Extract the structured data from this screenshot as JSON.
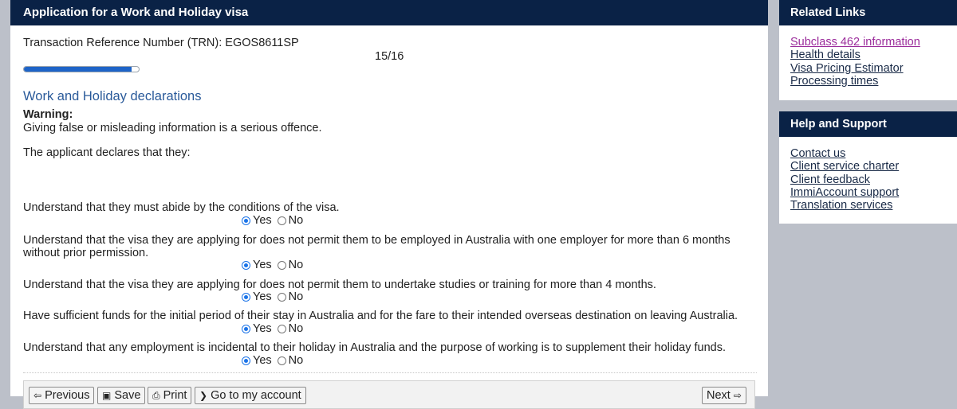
{
  "main": {
    "title": "Application for a Work and Holiday visa",
    "trn": "Transaction Reference Number (TRN): EGOS8611SP",
    "page_counter": "15/16",
    "progress": 0.9375,
    "section_title": "Work and Holiday declarations",
    "warning_label": "Warning:",
    "warning_text": "Giving false or misleading information is a serious offence.",
    "intro": "The applicant declares that they:",
    "questions": [
      {
        "text": "Understand that they must abide by the conditions of the visa.",
        "selected": "Yes"
      },
      {
        "text": "Understand that the visa they are applying for does not permit them to be employed in Australia with one employer for more than 6 months without prior permission.",
        "selected": "Yes"
      },
      {
        "text": "Understand that the visa they are applying for does not permit them to undertake studies or training for more than 4 months.",
        "selected": "Yes"
      },
      {
        "text": "Have sufficient funds for the initial period of their stay in Australia and for the fare to their intended overseas destination on leaving Australia.",
        "selected": "Yes"
      },
      {
        "text": "Understand that any employment is incidental to their holiday in Australia and the purpose of working is to supplement their holiday funds.",
        "selected": "Yes"
      }
    ],
    "yes_label": "Yes",
    "no_label": "No"
  },
  "toolbar": {
    "previous": "Previous",
    "save": "Save",
    "print": "Print",
    "account": "Go to my account",
    "next": "Next"
  },
  "related_links": {
    "title": "Related Links",
    "items": [
      "Subclass 462 information",
      "Health details",
      "Visa Pricing Estimator",
      "Processing times"
    ]
  },
  "help_support": {
    "title": "Help and Support",
    "items": [
      "Contact us",
      "Client service charter",
      "Client feedback",
      "ImmiAccount support",
      "Translation services"
    ]
  },
  "colors": {
    "header_bg": "#0a2246",
    "section_title": "#2a5a9a",
    "visited_link": "#9b2c9b",
    "radio_selected": "#1a73e8"
  }
}
